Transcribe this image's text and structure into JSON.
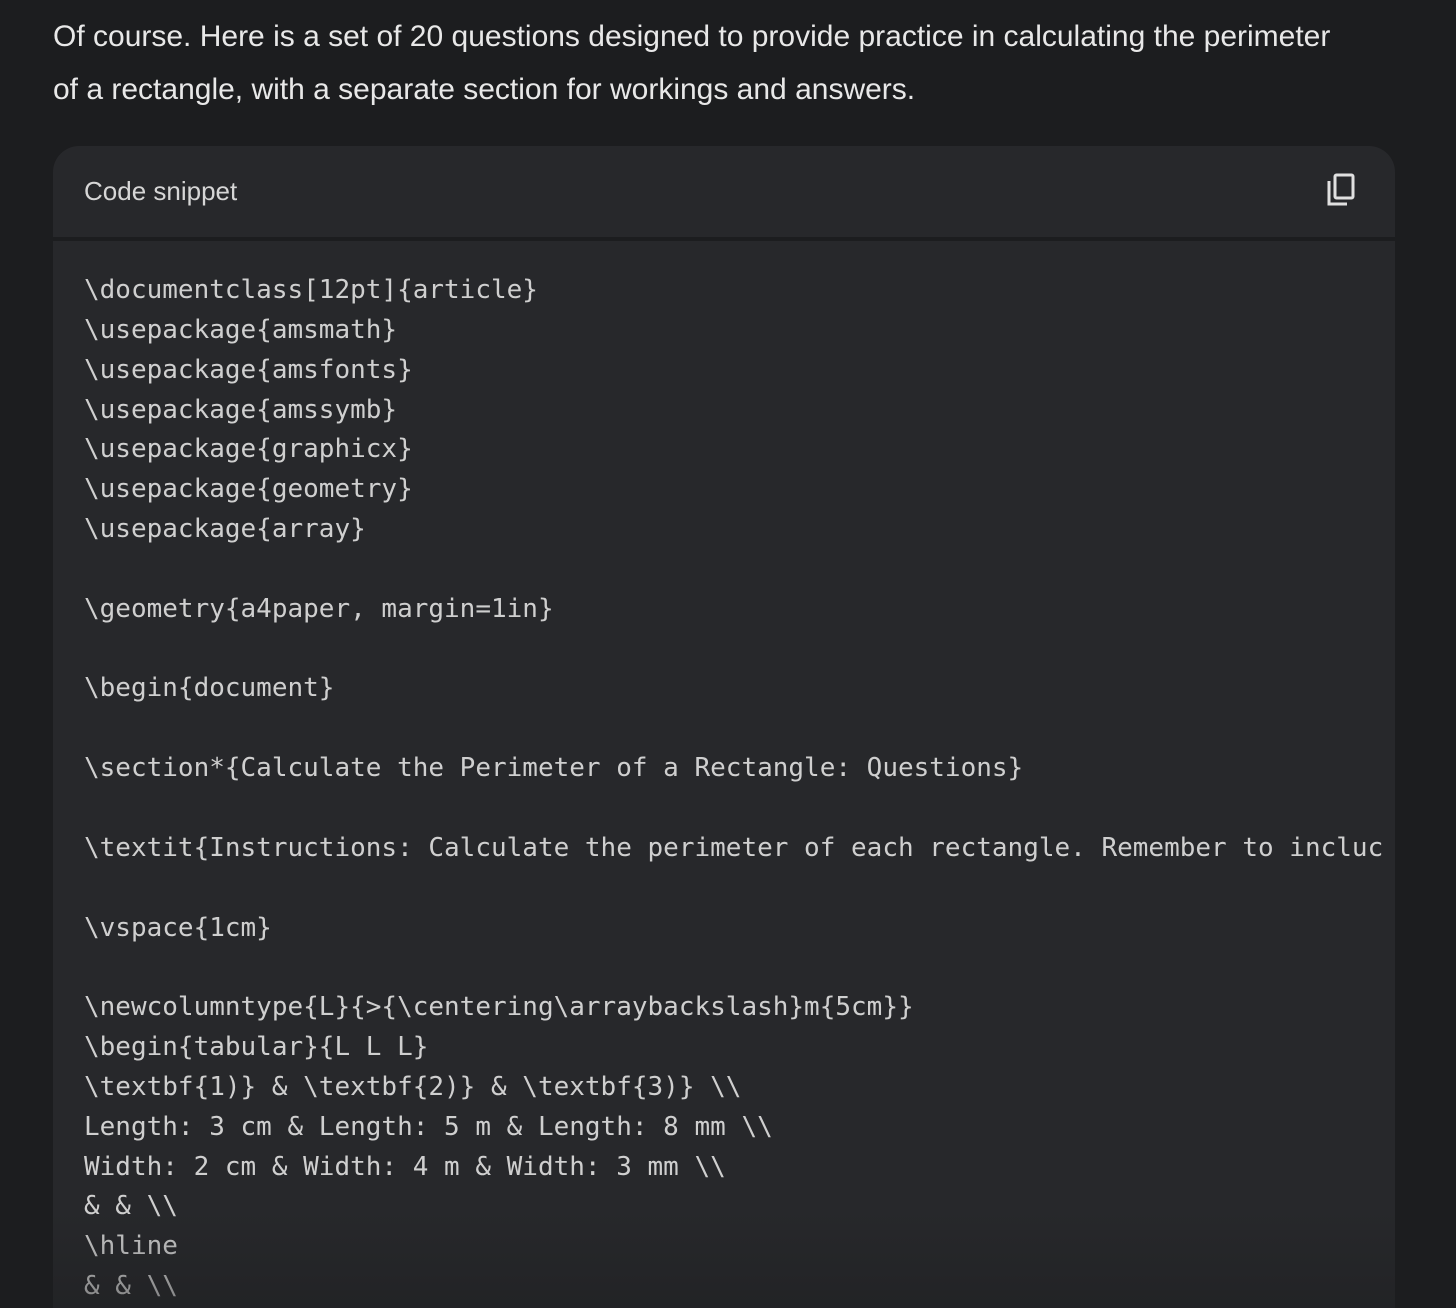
{
  "message": {
    "intro_line1": "Of course. Here is a set of 20 questions designed to provide practice in calculating the perimeter",
    "intro_line2": "of a rectangle, with a separate section for workings and answers."
  },
  "code_block": {
    "title": "Code snippet",
    "copy_icon": "copy-icon",
    "lines": [
      "\\documentclass[12pt]{article}",
      "\\usepackage{amsmath}",
      "\\usepackage{amsfonts}",
      "\\usepackage{amssymb}",
      "\\usepackage{graphicx}",
      "\\usepackage{geometry}",
      "\\usepackage{array}",
      "",
      "\\geometry{a4paper, margin=1in}",
      "",
      "\\begin{document}",
      "",
      "\\section*{Calculate the Perimeter of a Rectangle: Questions}",
      "",
      "\\textit{Instructions: Calculate the perimeter of each rectangle. Remember to incluc",
      "",
      "\\vspace{1cm}",
      "",
      "\\newcolumntype{L}{>{\\centering\\arraybackslash}m{5cm}}",
      "\\begin{tabular}{L L L}",
      "\\textbf{1)} & \\textbf{2)} & \\textbf{3)} \\\\",
      "Length: 3 cm & Length: 5 m & Length: 8 mm \\\\",
      "Width: 2 cm & Width: 4 m & Width: 3 mm \\\\",
      "& & \\\\",
      "\\hline",
      "& & \\\\"
    ]
  },
  "colors": {
    "page_background": "#1c1d1f",
    "card_background": "#27282b",
    "text": "#e8e8e8",
    "code_text": "#cfcfcf"
  }
}
